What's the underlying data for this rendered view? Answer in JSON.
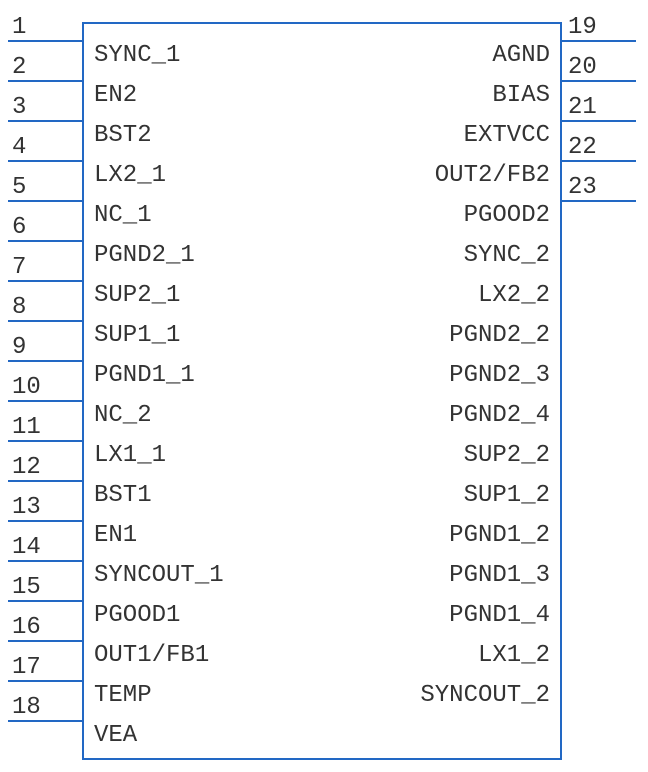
{
  "chip": {
    "bodyLeft": 82,
    "bodyRight": 562,
    "bodyTop": 22,
    "bodyBottom": 760,
    "pinLineLen": 74,
    "rowPitch": 40,
    "firstRowY": 40,
    "numHeight": 26
  },
  "left_pins": [
    {
      "num": "1",
      "label": "SYNC_1"
    },
    {
      "num": "2",
      "label": "EN2"
    },
    {
      "num": "3",
      "label": "BST2"
    },
    {
      "num": "4",
      "label": "LX2_1"
    },
    {
      "num": "5",
      "label": "NC_1"
    },
    {
      "num": "6",
      "label": "PGND2_1"
    },
    {
      "num": "7",
      "label": "SUP2_1"
    },
    {
      "num": "8",
      "label": "SUP1_1"
    },
    {
      "num": "9",
      "label": "PGND1_1"
    },
    {
      "num": "10",
      "label": "NC_2"
    },
    {
      "num": "11",
      "label": "LX1_1"
    },
    {
      "num": "12",
      "label": "BST1"
    },
    {
      "num": "13",
      "label": "EN1"
    },
    {
      "num": "14",
      "label": "SYNCOUT_1"
    },
    {
      "num": "15",
      "label": "PGOOD1"
    },
    {
      "num": "16",
      "label": "OUT1/FB1"
    },
    {
      "num": "17",
      "label": "TEMP"
    },
    {
      "num": "18",
      "label": "VEA"
    }
  ],
  "right_pins": [
    {
      "num": "19",
      "label": "AGND"
    },
    {
      "num": "20",
      "label": "BIAS"
    },
    {
      "num": "21",
      "label": "EXTVCC"
    },
    {
      "num": "22",
      "label": "OUT2/FB2"
    },
    {
      "num": "23",
      "label": "PGOOD2"
    },
    {
      "num": "",
      "label": "SYNC_2"
    },
    {
      "num": "",
      "label": "LX2_2"
    },
    {
      "num": "",
      "label": "PGND2_2"
    },
    {
      "num": "",
      "label": "PGND2_3"
    },
    {
      "num": "",
      "label": "PGND2_4"
    },
    {
      "num": "",
      "label": "SUP2_2"
    },
    {
      "num": "",
      "label": "SUP1_2"
    },
    {
      "num": "",
      "label": "PGND1_2"
    },
    {
      "num": "",
      "label": "PGND1_3"
    },
    {
      "num": "",
      "label": "PGND1_4"
    },
    {
      "num": "",
      "label": "LX1_2"
    },
    {
      "num": "",
      "label": "SYNCOUT_2"
    }
  ]
}
